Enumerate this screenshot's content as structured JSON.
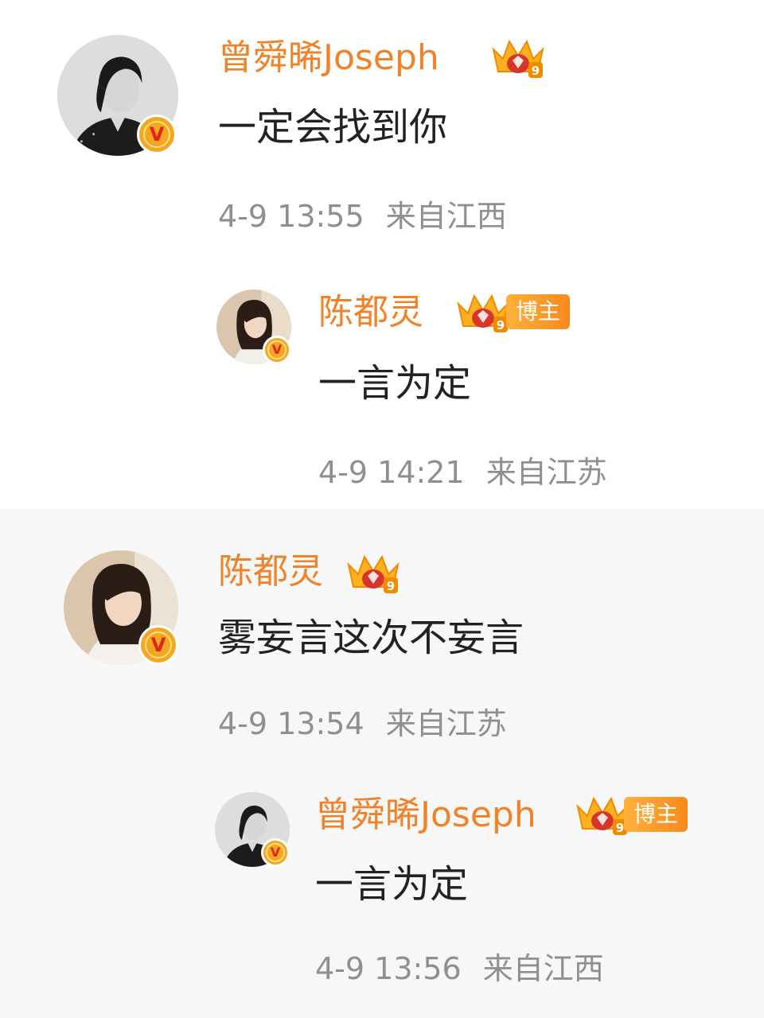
{
  "comments": [
    {
      "author": "曾舜晞Joseph",
      "text": "一定会找到你",
      "time": "4-9 13:55",
      "location": "来自江西",
      "crown_level": "9",
      "verified_icon": "v-verified-icon",
      "reply": {
        "author": "陈都灵",
        "badge": "博主",
        "text": "一言为定",
        "time": "4-9 14:21",
        "location": "来自江苏",
        "crown_level": "9"
      }
    },
    {
      "author": "陈都灵",
      "text": "雾妄言这次不妄言",
      "time": "4-9 13:54",
      "location": "来自江苏",
      "crown_level": "9",
      "reply": {
        "author": "曾舜晞Joseph",
        "badge": "博主",
        "text": "一言为定",
        "time": "4-9 13:56",
        "location": "来自江西",
        "crown_level": "9"
      }
    }
  ],
  "colors": {
    "name": "#f0822a",
    "text": "#222222",
    "meta": "#8f8f8f",
    "badge_gradient_start": "#ffb13b",
    "verified": "#f5a623",
    "verified_v": "#e0251b"
  }
}
